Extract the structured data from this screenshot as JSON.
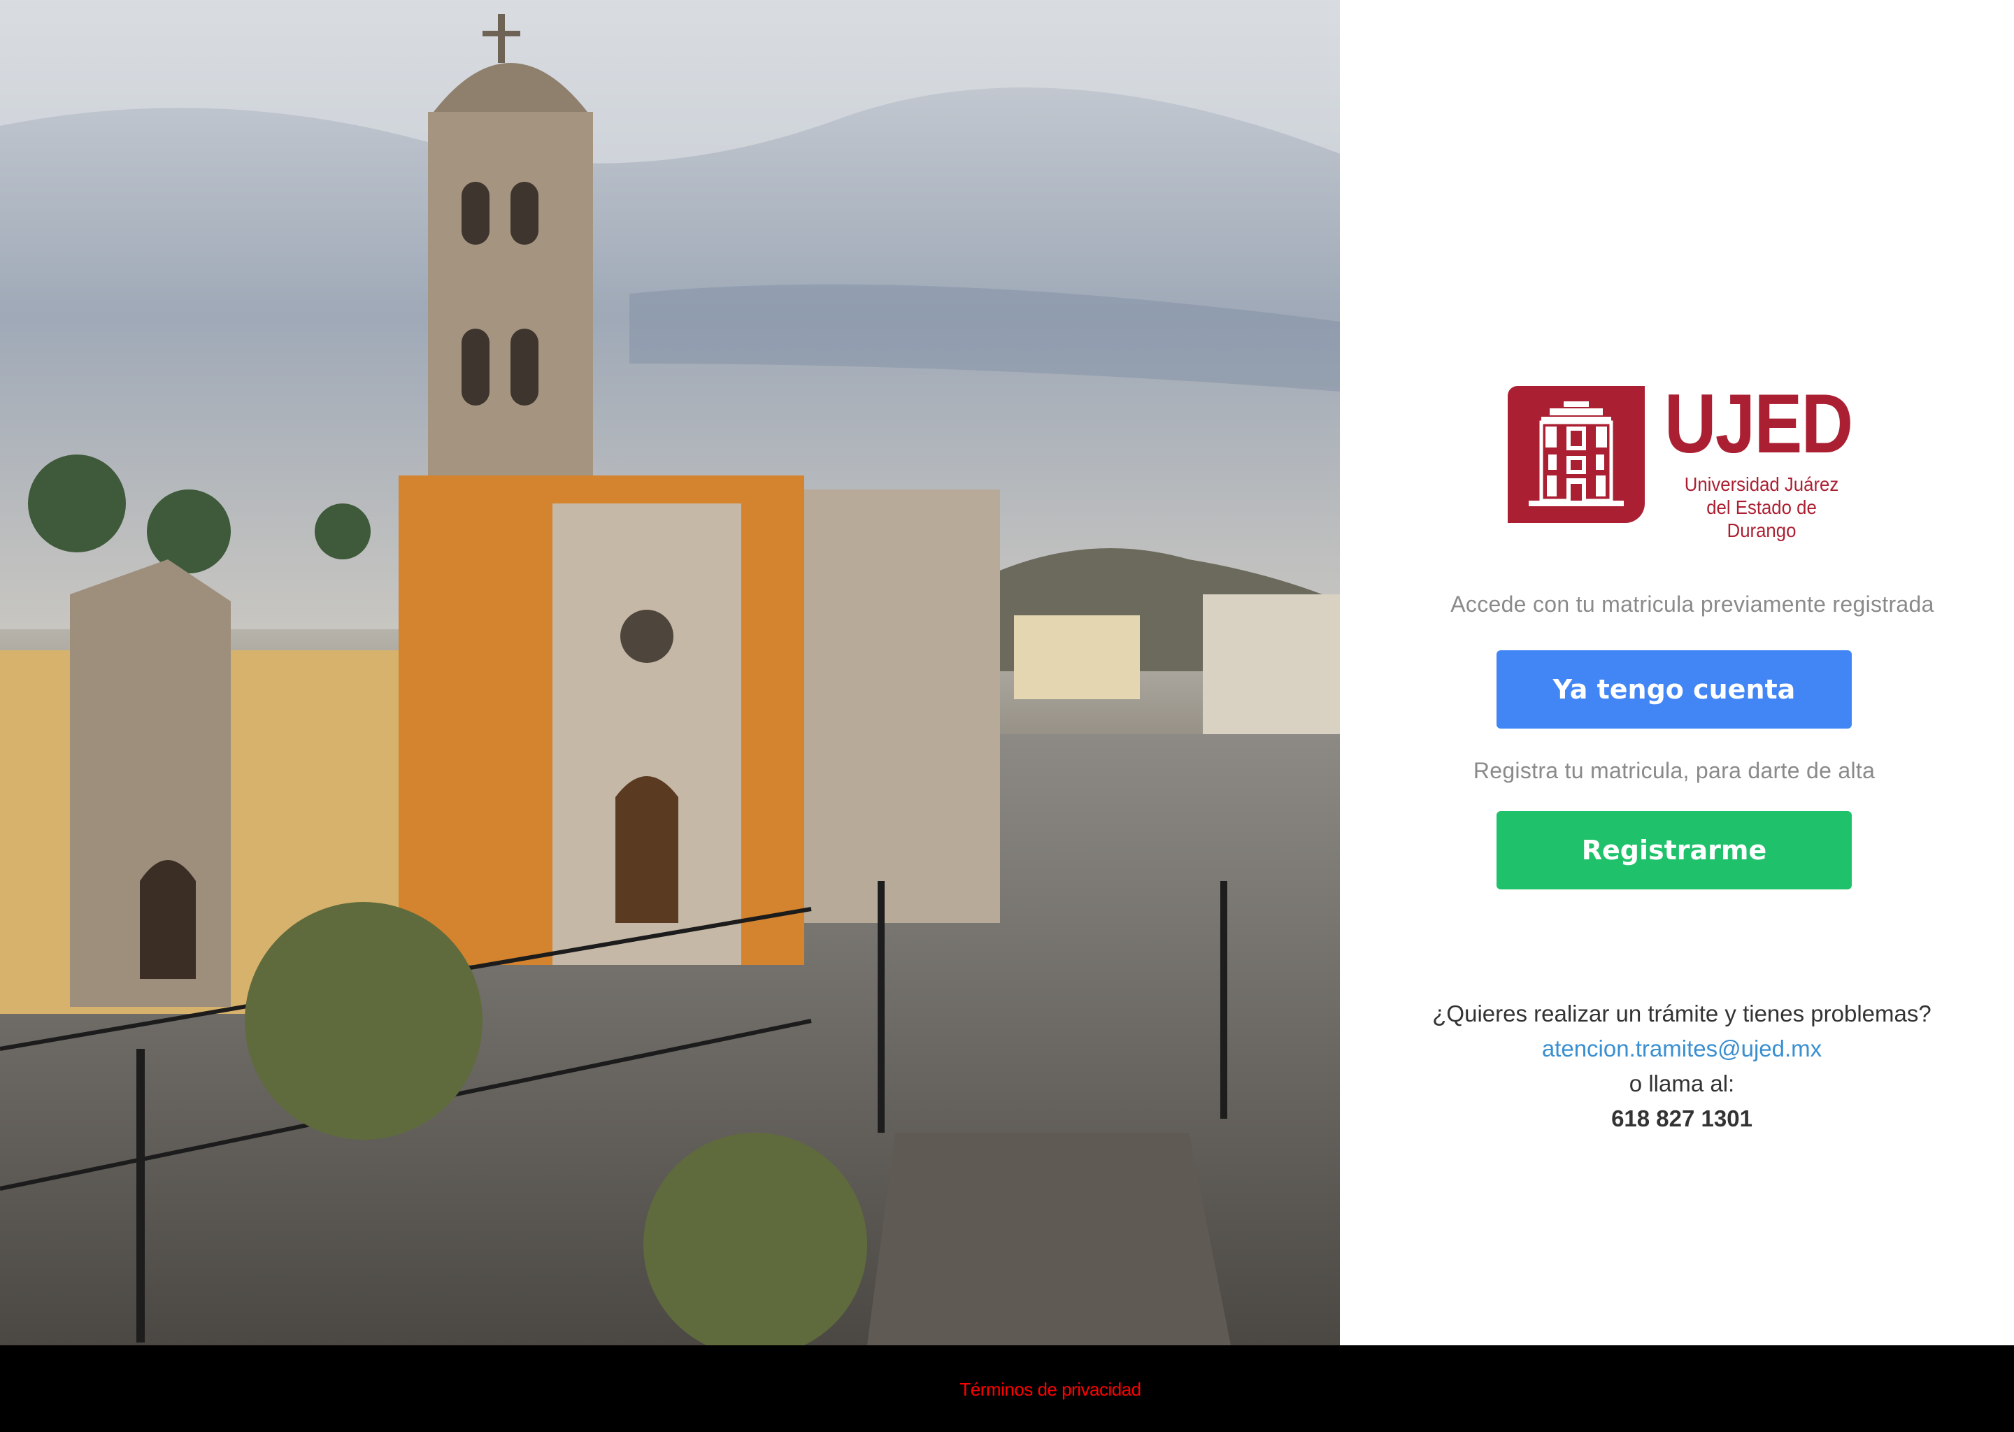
{
  "hero": {
    "image_alt": "Catedral y plaza de Durango"
  },
  "brand": {
    "acronym": "UJED",
    "name_line1": "Universidad Juárez",
    "name_line2": "del Estado de Durango",
    "color": "#ab1f32"
  },
  "login": {
    "prompt": "Accede con tu matricula previamente registrada",
    "button_label": "Ya tengo cuenta",
    "button_color": "#4285f4"
  },
  "register": {
    "prompt": "Registra tu matricula, para darte de alta",
    "button_label": "Registrarme",
    "button_color": "#1fc26b"
  },
  "help": {
    "question": "¿Quieres realizar un trámite y tienes problemas?",
    "email": "atencion.tramites@ujed.mx",
    "call_text": "o llama al:",
    "phone": "618 827 1301"
  },
  "footer": {
    "privacy_link": "Términos de privacidad",
    "link_color": "#ff0000"
  }
}
